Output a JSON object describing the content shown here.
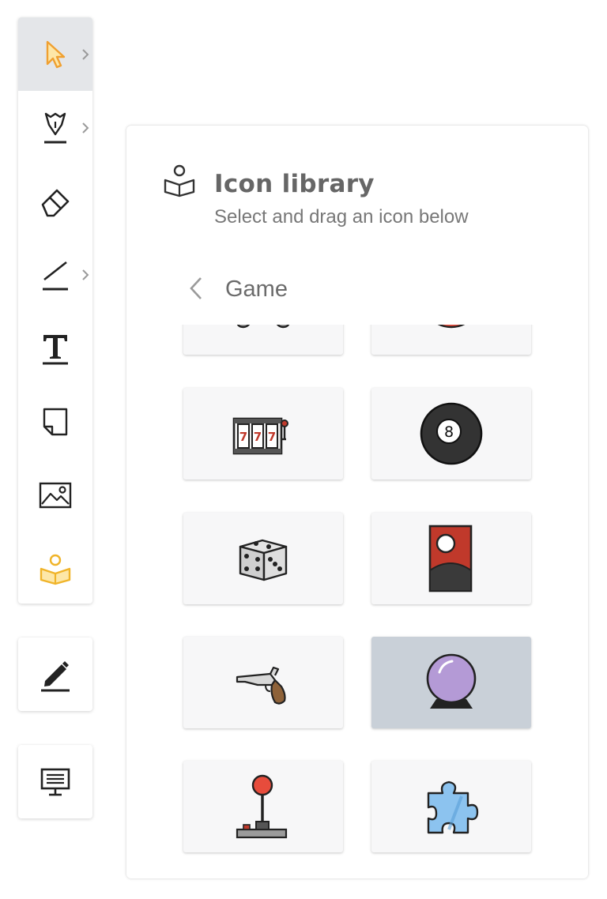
{
  "toolbar": {
    "tools": [
      {
        "name": "select-tool",
        "icon": "cursor-icon",
        "active": true,
        "has_submenu": true
      },
      {
        "name": "pen-tool",
        "icon": "pen-nib-icon",
        "active": false,
        "has_submenu": true
      },
      {
        "name": "eraser-tool",
        "icon": "eraser-icon",
        "active": false,
        "has_submenu": false
      },
      {
        "name": "line-tool",
        "icon": "line-icon",
        "active": false,
        "has_submenu": true
      },
      {
        "name": "text-tool",
        "icon": "text-icon",
        "active": false,
        "has_submenu": false
      },
      {
        "name": "sticky-note-tool",
        "icon": "sticky-note-icon",
        "active": false,
        "has_submenu": false
      },
      {
        "name": "image-tool",
        "icon": "image-icon",
        "active": false,
        "has_submenu": false
      },
      {
        "name": "icon-library-tool",
        "icon": "book-reader-icon",
        "active": true,
        "has_submenu": false
      }
    ],
    "annotate_button_icon": "pencil-icon",
    "present_button_icon": "monitor-icon",
    "accent_color": "#f0b429"
  },
  "library": {
    "title": "Icon library",
    "subtitle": "Select and drag an icon below",
    "category": "Game",
    "icons": [
      {
        "name": "gamepad-icon",
        "selected": false
      },
      {
        "name": "dartboard-icon",
        "selected": false
      },
      {
        "name": "slot-machine-icon",
        "selected": false
      },
      {
        "name": "eight-ball-icon",
        "selected": false
      },
      {
        "name": "dice-icon",
        "selected": false
      },
      {
        "name": "cornhole-board-icon",
        "selected": false
      },
      {
        "name": "revolver-icon",
        "selected": false
      },
      {
        "name": "crystal-ball-icon",
        "selected": true
      },
      {
        "name": "joystick-icon",
        "selected": false
      },
      {
        "name": "puzzle-piece-icon",
        "selected": false
      }
    ],
    "slot_text": "7"
  }
}
